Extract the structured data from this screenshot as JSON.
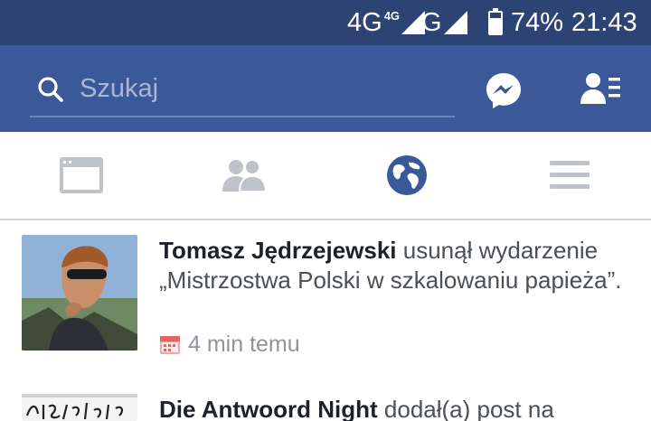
{
  "status_bar": {
    "network1": "4G",
    "network1_small": "4G",
    "network2": "G",
    "battery": "74%",
    "time": "21:43"
  },
  "header": {
    "search_placeholder": "Szukaj",
    "messenger_icon": "messenger-icon",
    "friend_requests_icon": "friend-requests-icon"
  },
  "tabs": [
    {
      "name": "news-feed",
      "icon": "news-feed-icon",
      "active": false
    },
    {
      "name": "friends",
      "icon": "friends-icon",
      "active": false
    },
    {
      "name": "notifications",
      "icon": "globe-icon",
      "active": true
    },
    {
      "name": "menu",
      "icon": "hamburger-icon",
      "active": false
    }
  ],
  "colors": {
    "status_bar": "#2d4373",
    "header": "#3b5998",
    "accent": "#3b5998",
    "inactive_icon": "#bec3c9"
  },
  "notifications": [
    {
      "name": "Tomasz Jędrzejewski",
      "action": " usunął wydarzenie „Mistrzostwa Polski w szkalowaniu papieża”.",
      "time": "4 min temu"
    },
    {
      "name": "Die Antwoord Night",
      "action": " dodał(a) post na"
    }
  ]
}
